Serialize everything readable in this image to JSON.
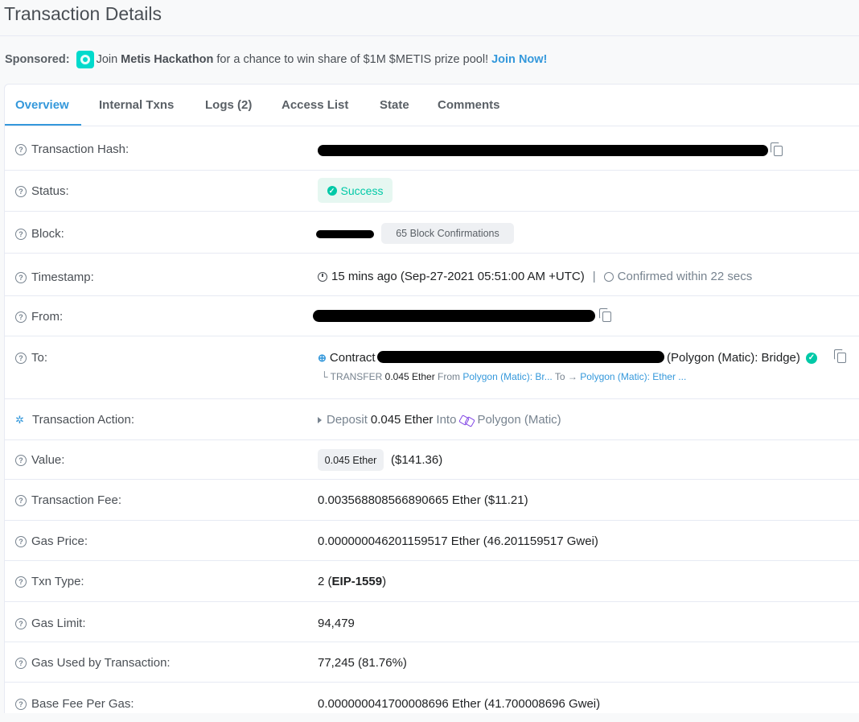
{
  "page": {
    "title": "Transaction Details"
  },
  "sponsor": {
    "label": "Sponsored:",
    "text_before": "Join",
    "bold": "Metis Hackathon",
    "text_after": "for a chance to win share of $1M $METIS prize pool!",
    "link": "Join Now!"
  },
  "tabs": [
    {
      "label": "Overview",
      "active": true
    },
    {
      "label": "Internal Txns"
    },
    {
      "label": "Logs (2)"
    },
    {
      "label": "Access List"
    },
    {
      "label": "State"
    },
    {
      "label": "Comments"
    }
  ],
  "details": {
    "tx_hash": {
      "label": "Transaction Hash:"
    },
    "status": {
      "label": "Status:",
      "value": "Success"
    },
    "block": {
      "label": "Block:",
      "confirmations": "65 Block Confirmations"
    },
    "timestamp": {
      "label": "Timestamp:",
      "value": "15 mins ago (Sep-27-2021 05:51:00 AM +UTC)",
      "separator": "|",
      "confirmed": "Confirmed within 22 secs"
    },
    "from": {
      "label": "From:"
    },
    "to": {
      "label": "To:",
      "prefix": "Contract",
      "name": "(Polygon (Matic): Bridge)",
      "transfer_prefix": "└ TRANSFER",
      "transfer_amount": "0.045 Ether",
      "transfer_from_label": "From",
      "transfer_from": "Polygon (Matic): Br...",
      "transfer_to_label": "To →",
      "transfer_to": "Polygon (Matic): Ether ..."
    },
    "action": {
      "label": "Transaction Action:",
      "verb": "Deposit",
      "amount": "0.045 Ether",
      "into": "Into",
      "target": "Polygon (Matic)"
    },
    "value": {
      "label": "Value:",
      "amount": "0.045 Ether",
      "usd": "($141.36)"
    },
    "fee": {
      "label": "Transaction Fee:",
      "value": "0.003568808566890665 Ether ($11.21)"
    },
    "gas_price": {
      "label": "Gas Price:",
      "value": "0.000000046201159517 Ether (46.201159517 Gwei)"
    },
    "txn_type": {
      "label": "Txn Type:",
      "prefix": "2 (",
      "bold": "EIP-1559",
      "suffix": ")"
    },
    "gas_limit": {
      "label": "Gas Limit:",
      "value": "94,479"
    },
    "gas_used": {
      "label": "Gas Used by Transaction:",
      "value": "77,245 (81.76%)"
    },
    "base_fee": {
      "label": "Base Fee Per Gas:",
      "value": "0.000000041700008696 Ether (41.700008696 Gwei)"
    }
  },
  "colors": {
    "accent": "#3498db",
    "success": "#00c9a7",
    "polygon": "#8247e5"
  }
}
